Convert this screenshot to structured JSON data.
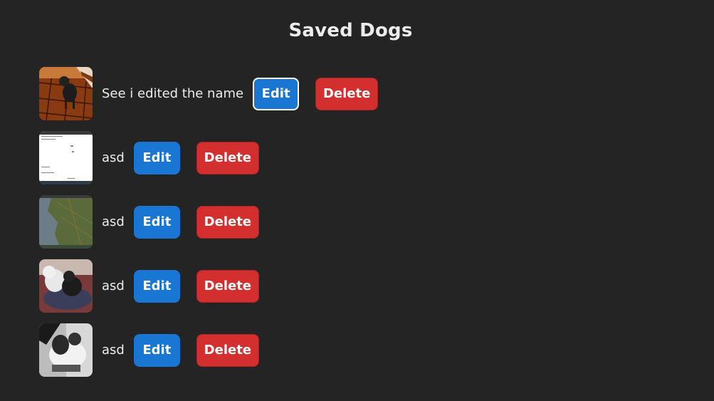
{
  "page": {
    "title": "Saved Dogs"
  },
  "colors": {
    "background": "#242424",
    "edit_button": "#1976d2",
    "delete_button": "#d32f2f",
    "text": "#ececec"
  },
  "dogs": [
    {
      "name": "See i edited the name",
      "edit_label": "Edit",
      "delete_label": "Delete",
      "image": "dog-standing-on-tile-floor",
      "edit_focused": true
    },
    {
      "name": "asd",
      "edit_label": "Edit",
      "delete_label": "Delete",
      "image": "screenshot-thumbnail",
      "edit_focused": false
    },
    {
      "name": "asd",
      "edit_label": "Edit",
      "delete_label": "Delete",
      "image": "map-thumbnail",
      "edit_focused": false
    },
    {
      "name": "asd",
      "edit_label": "Edit",
      "delete_label": "Delete",
      "image": "two-dogs-on-rug",
      "edit_focused": false
    },
    {
      "name": "asd",
      "edit_label": "Edit",
      "delete_label": "Delete",
      "image": "dog-black-and-white",
      "edit_focused": false
    }
  ]
}
